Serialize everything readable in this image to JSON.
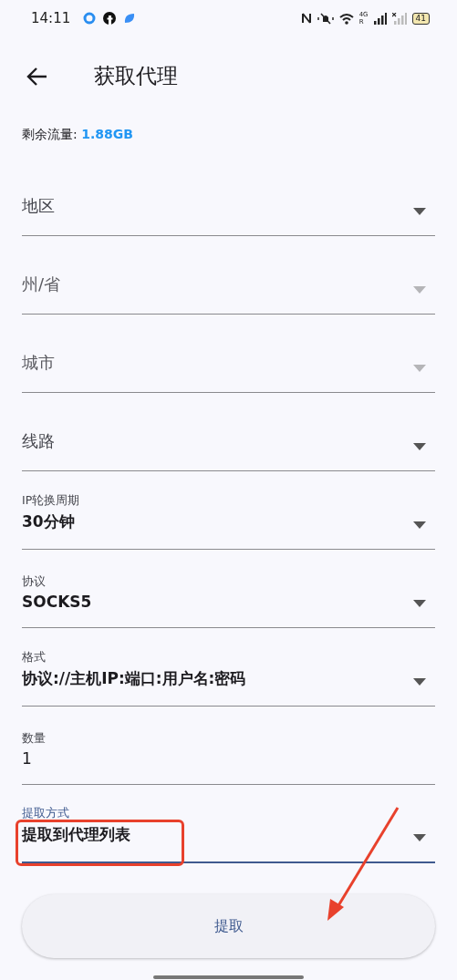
{
  "status_bar": {
    "time": "14:11",
    "network_type": "4G",
    "roaming": "R",
    "battery": "41"
  },
  "app_bar": {
    "title": "获取代理"
  },
  "balance": {
    "label": "剩余流量: ",
    "value": "1.88GB"
  },
  "fields": [
    {
      "kind": "empty",
      "label": "地区",
      "disabled": false,
      "focused": false,
      "highlighted": false
    },
    {
      "kind": "empty",
      "label": "州/省",
      "disabled": true,
      "focused": false,
      "highlighted": false
    },
    {
      "kind": "empty",
      "label": "城市",
      "disabled": true,
      "focused": false,
      "highlighted": false
    },
    {
      "kind": "empty",
      "label": "线路",
      "disabled": false,
      "focused": false,
      "highlighted": false
    },
    {
      "kind": "filled",
      "label": "IP轮换周期",
      "value": "30分钟",
      "disabled": false,
      "focused": false,
      "highlighted": false
    },
    {
      "kind": "filled",
      "label": "协议",
      "value": "SOCKS5",
      "disabled": false,
      "focused": false,
      "highlighted": false
    },
    {
      "kind": "filled",
      "label": "格式",
      "value": "协议://主机IP:端口:用户名:密码",
      "disabled": false,
      "focused": false,
      "highlighted": false
    },
    {
      "kind": "input",
      "label": "数量",
      "value": "1",
      "disabled": false,
      "focused": false,
      "highlighted": false
    },
    {
      "kind": "filled",
      "label": "提取方式",
      "value": "提取到代理列表",
      "disabled": false,
      "focused": true,
      "highlighted": true
    }
  ],
  "submit_button": {
    "label": "提取"
  },
  "annotation_arrow": true
}
